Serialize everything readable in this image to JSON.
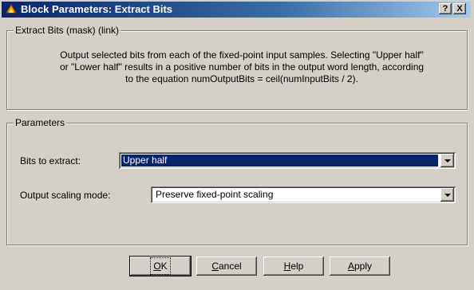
{
  "window": {
    "title": "Block Parameters: Extract Bits",
    "help_glyph": "?",
    "close_glyph": "X"
  },
  "mask_group": {
    "legend": "Extract Bits (mask) (link)",
    "description_lines": [
      "Output selected bits from each of the fixed-point input samples. Selecting \"Upper half\"",
      "or \"Lower half\" results in a positive number of bits in the output word length, according",
      "to the equation numOutputBits = ceil(numInputBits / 2)."
    ]
  },
  "params_group": {
    "legend": "Parameters",
    "bits_label": "Bits to extract:",
    "bits_value": "Upper half",
    "scaling_label": "Output scaling mode:",
    "scaling_value": "Preserve fixed-point scaling"
  },
  "buttons": {
    "ok_mnemonic": "O",
    "ok_rest": "K",
    "cancel_mnemonic": "C",
    "cancel_rest": "ancel",
    "help_mnemonic": "H",
    "help_rest": "elp",
    "apply_mnemonic": "A",
    "apply_rest": "pply"
  },
  "colors": {
    "title_start": "#0a246a",
    "title_end": "#a6caf0",
    "face": "#d4d0c8",
    "selection": "#0a246a"
  },
  "icons": {
    "title_icon": "simulink-block-icon",
    "combo_arrow": "chevron-down-icon"
  }
}
